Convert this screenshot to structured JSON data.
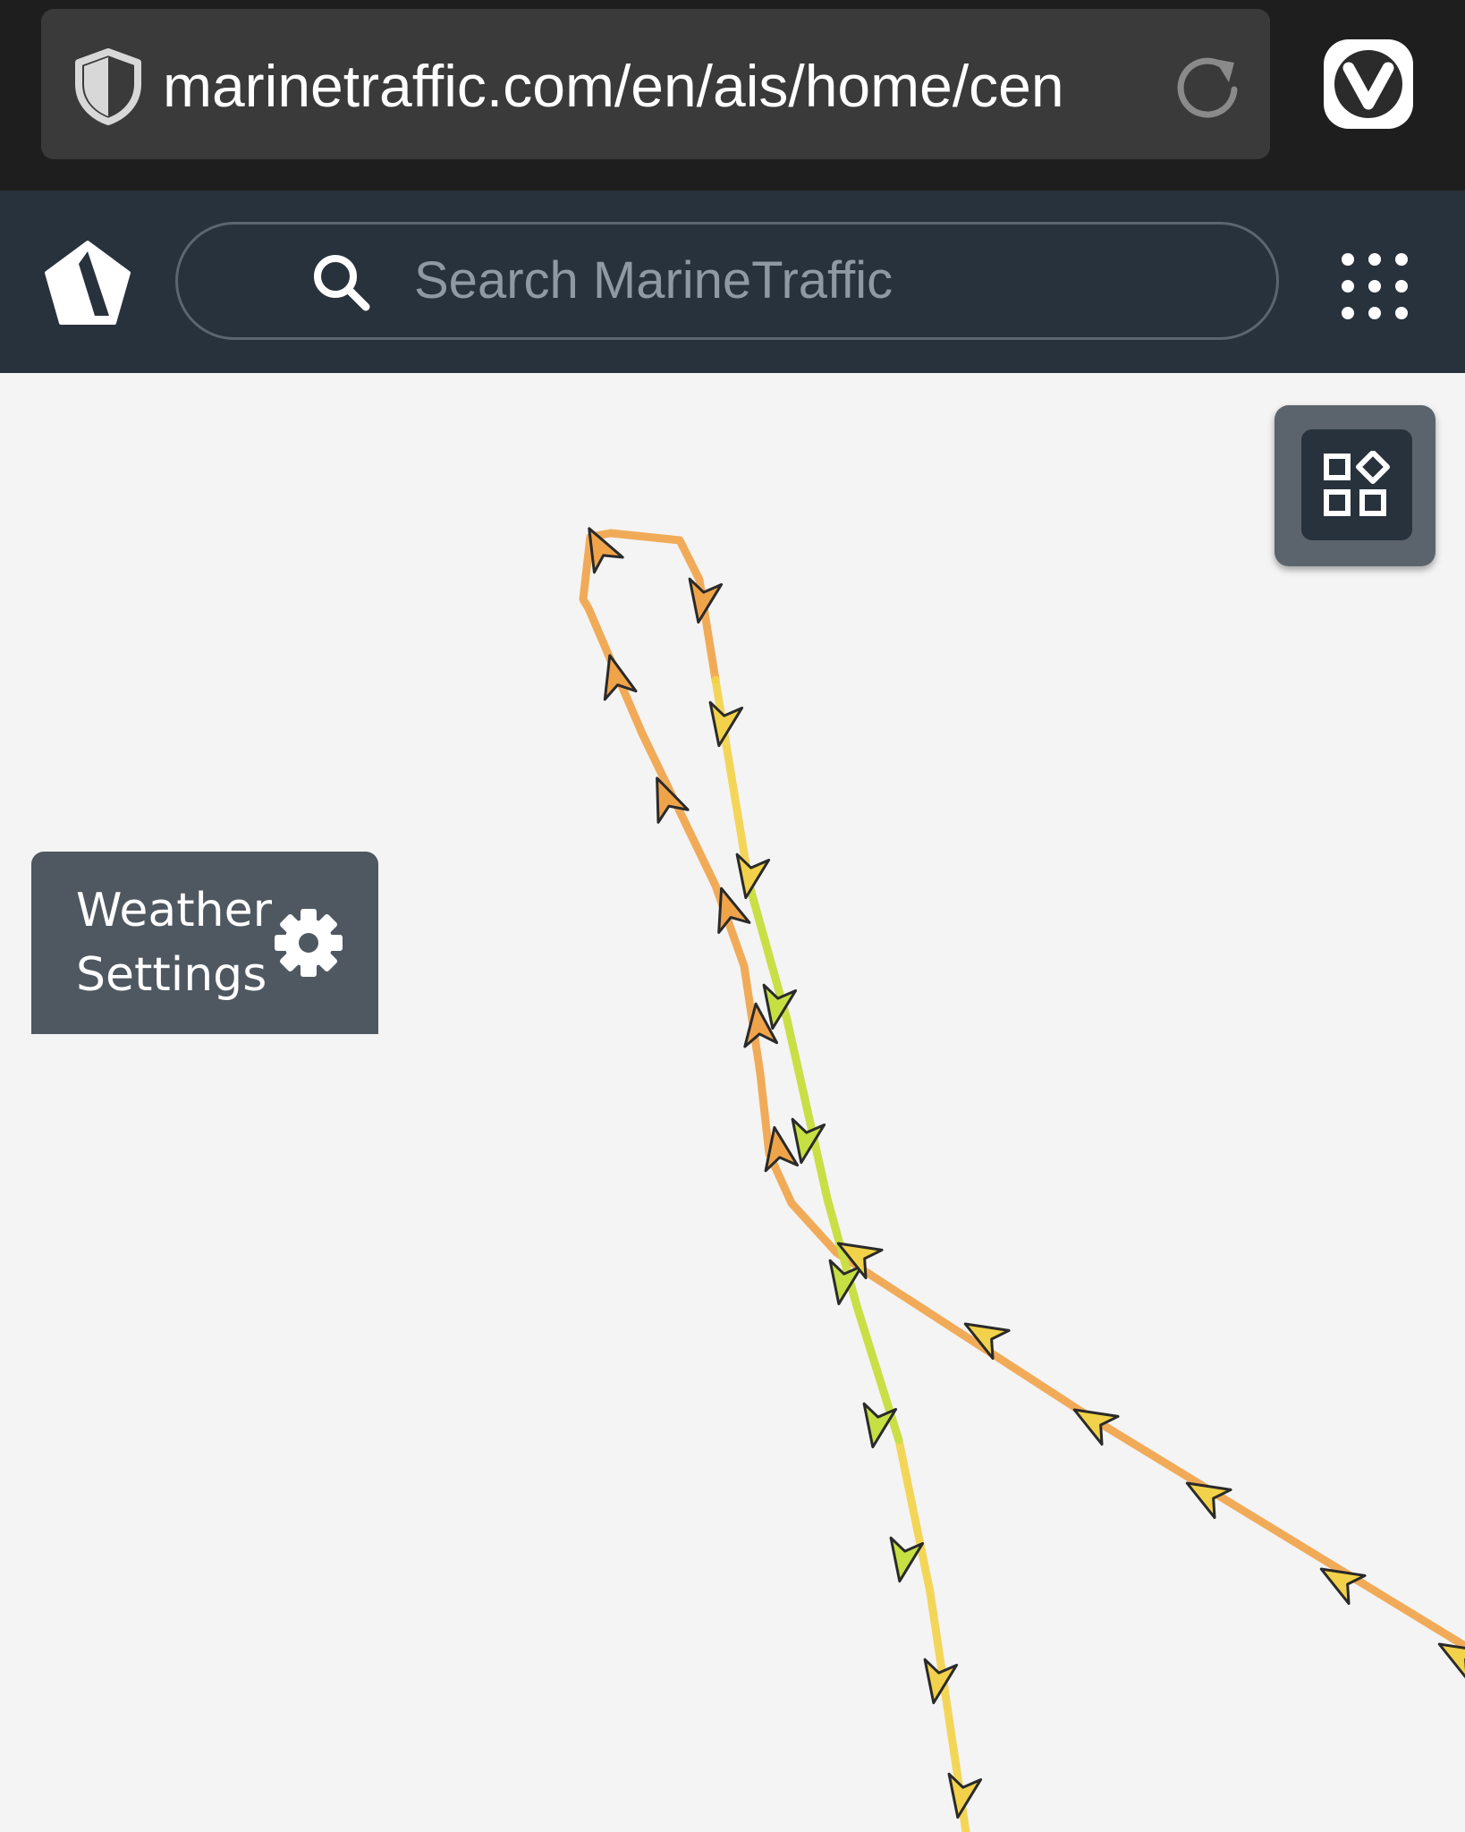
{
  "browser": {
    "url": "marinetraffic.com/en/ais/home/cen"
  },
  "header": {
    "search_placeholder": "Search MarineTraffic"
  },
  "weather": {
    "line1": "Weather",
    "line2": "Settings"
  },
  "map": {
    "track_colors": {
      "orange": "#f0a44a",
      "yellow": "#f2d24a",
      "lime": "#c6e044"
    }
  },
  "colors": {
    "browser_bar": "#1e1e1e",
    "url_box": "#3a3a3a",
    "app_header": "#28323c",
    "panel": "#4f5861",
    "map_background": "#f4f4f4"
  },
  "icons": [
    "shield-icon",
    "reload-icon",
    "vivaldi-icon",
    "logo-icon",
    "search-icon",
    "apps-icon",
    "layers-icon",
    "gear-icon"
  ]
}
